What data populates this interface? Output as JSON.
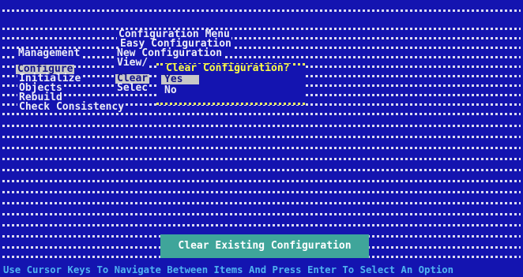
{
  "menu_title": "Configuration Menu",
  "config_menu": {
    "items": [
      "Easy Configuration",
      "New Configuration",
      "View/",
      "Clear",
      "Selec"
    ]
  },
  "management_label": "Management",
  "main_menu": {
    "items": [
      "Configure",
      "Initialize",
      "Objects",
      "Rebuild",
      "Check Consistency"
    ]
  },
  "dialog": {
    "title": "Clear Configuration?",
    "options": [
      "Yes",
      "No"
    ]
  },
  "status_box": "Clear Existing Configuration",
  "footer": "Use Cursor Keys To Navigate Between Items And Press Enter To Select An Option",
  "colors": {
    "background": "#1414b0",
    "dots": "#dcdcf2",
    "highlight": "#c8c8c8",
    "dialog_title": "#ffff44",
    "status_box": "#3fa59a",
    "footer_text": "#4fb4f0"
  }
}
